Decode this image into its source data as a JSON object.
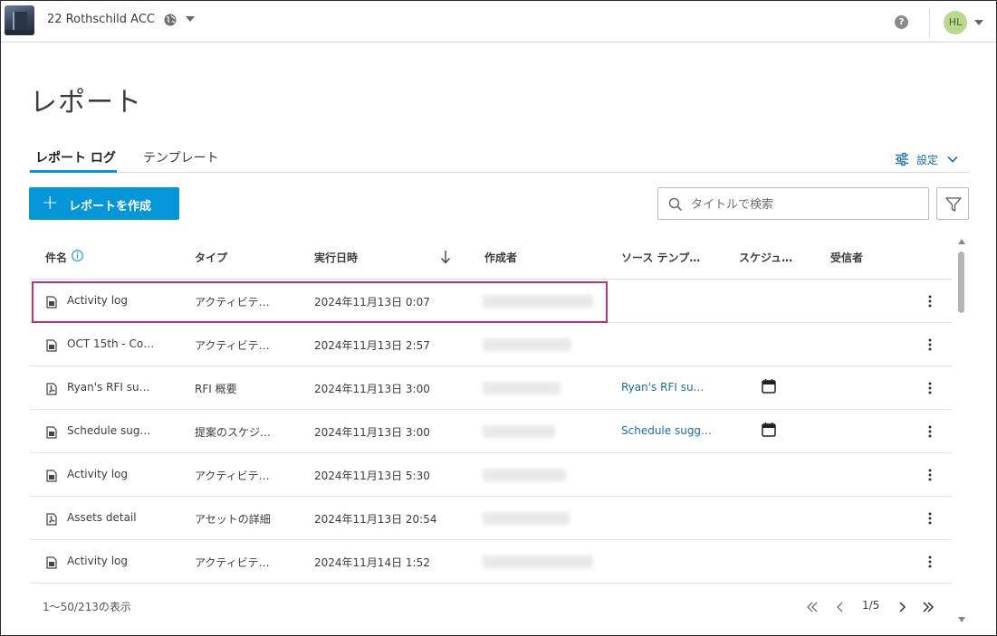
{
  "project": {
    "name": "22 Rothschild ACC",
    "thumb_icon": "building-icon",
    "globe_icon": "globe-icon"
  },
  "user": {
    "initials": "HL"
  },
  "page": {
    "title": "レポート"
  },
  "tabs": [
    {
      "label": "レポート ログ",
      "active": true
    },
    {
      "label": "テンプレート",
      "active": false
    }
  ],
  "settings": {
    "label": "設定"
  },
  "actions": {
    "create_label": "レポートを作成",
    "search_placeholder": "タイトルで検索"
  },
  "table": {
    "columns": [
      "件名",
      "タイプ",
      "実行日時",
      "作成者",
      "ソース テンプ…",
      "スケジュ…",
      "受信者"
    ],
    "sort": {
      "column": "実行日時",
      "direction": "descending"
    },
    "rows": [
      {
        "name": "Activity log",
        "type": "アクティビテ…",
        "date": "2024年11月13日 0:07",
        "source": "",
        "scheduled": false,
        "icon": "document-icon",
        "highlighted": true
      },
      {
        "name": "OCT 15th - Co…",
        "type": "アクティビテ…",
        "date": "2024年11月13日 2:57",
        "source": "",
        "scheduled": false,
        "icon": "document-icon",
        "highlighted": false
      },
      {
        "name": "Ryan's RFI su…",
        "type": "RFI 概要",
        "date": "2024年11月13日 3:00",
        "source": "Ryan's RFI su…",
        "scheduled": true,
        "icon": "pdf-icon",
        "highlighted": false
      },
      {
        "name": "Schedule sug…",
        "type": "提案のスケジ…",
        "date": "2024年11月13日 3:00",
        "source": "Schedule sugg…",
        "scheduled": true,
        "icon": "document-icon",
        "highlighted": false
      },
      {
        "name": "Activity log",
        "type": "アクティビテ…",
        "date": "2024年11月13日 5:30",
        "source": "",
        "scheduled": false,
        "icon": "document-icon",
        "highlighted": false
      },
      {
        "name": "Assets detail",
        "type": "アセットの詳細",
        "date": "2024年11月13日 20:54",
        "source": "",
        "scheduled": false,
        "icon": "pdf-icon",
        "highlighted": false
      },
      {
        "name": "Activity log",
        "type": "アクティビテ…",
        "date": "2024年11月14日 1:52",
        "source": "",
        "scheduled": false,
        "icon": "document-icon",
        "highlighted": false
      }
    ]
  },
  "footer": {
    "count_text": "1〜50/213の表示",
    "page_text": "1/5"
  },
  "colors": {
    "accent": "#0696d7",
    "link": "#1b6ea6",
    "highlight_border": "#c0307a",
    "avatar_bg": "#b9d98c"
  }
}
